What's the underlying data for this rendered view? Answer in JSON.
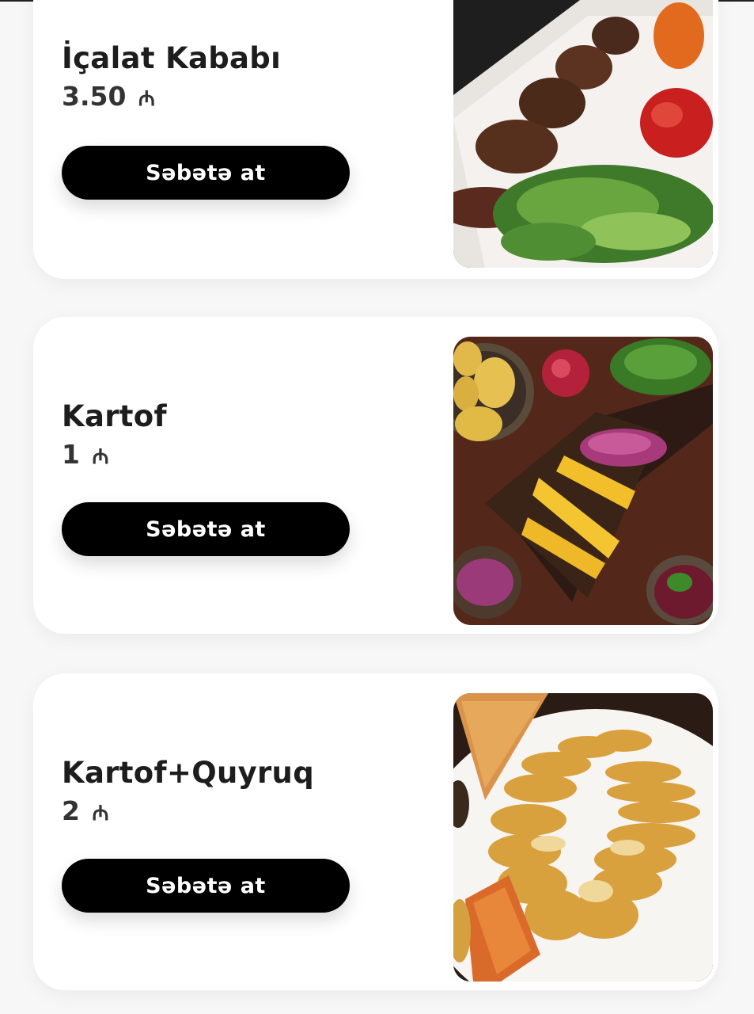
{
  "currency_symbol": "₼",
  "colors": {
    "background": "#f7f7f7",
    "card": "#ffffff",
    "button": "#000000",
    "button_text": "#ffffff",
    "title_text": "#1d1d1d"
  },
  "items": [
    {
      "name": "İçalat Kababı",
      "price": "3.50",
      "button_label": "Səbətə at",
      "image_icon": "kebab-plate-photo"
    },
    {
      "name": "Kartof",
      "price": "1",
      "button_label": "Səbətə at",
      "image_icon": "potato-kebab-board-photo"
    },
    {
      "name": "Kartof+Quyruq",
      "price": "2",
      "button_label": "Səbətə at",
      "image_icon": "potato-slices-plate-photo"
    }
  ]
}
